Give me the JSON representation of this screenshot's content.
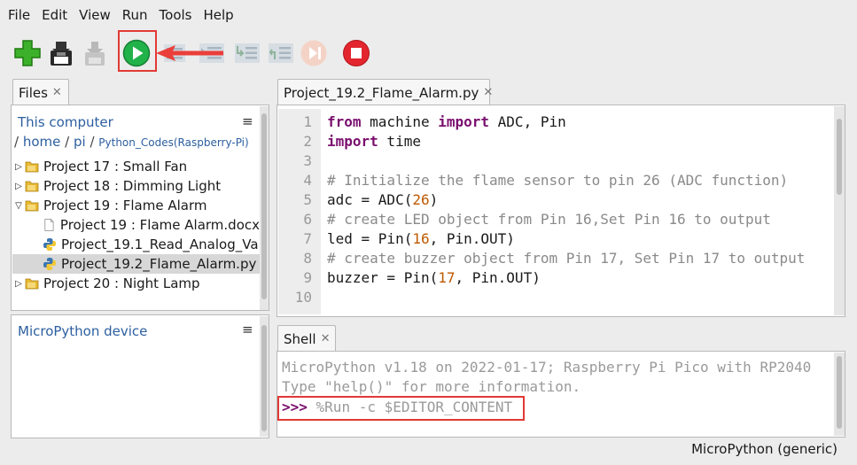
{
  "menu": [
    "File",
    "Edit",
    "View",
    "Run",
    "Tools",
    "Help"
  ],
  "toolbar": {
    "buttons": [
      {
        "name": "new-file",
        "icon": "plus-icon"
      },
      {
        "name": "save-file",
        "icon": "floppy-icon"
      },
      {
        "name": "load-file",
        "icon": "download-icon"
      },
      {
        "name": "run",
        "icon": "play-icon"
      },
      {
        "name": "debug",
        "icon": "debug-icon"
      },
      {
        "name": "step-over",
        "icon": "step-over-icon"
      },
      {
        "name": "step-into",
        "icon": "step-into-icon"
      },
      {
        "name": "step-out",
        "icon": "step-out-icon"
      },
      {
        "name": "resume",
        "icon": "resume-icon"
      },
      {
        "name": "stop",
        "icon": "stop-icon"
      }
    ],
    "accent": "#e23a35"
  },
  "files": {
    "tab_label": "Files",
    "computer_title": "This computer",
    "breadcrumb": [
      "home",
      "pi",
      "Python_Codes(Raspberry-Pi)"
    ],
    "tree": [
      {
        "label": "Project 17 : Small Fan",
        "type": "folder",
        "expanded": false
      },
      {
        "label": "Project 18 : Dimming Light",
        "type": "folder",
        "expanded": false
      },
      {
        "label": "Project 19 : Flame Alarm",
        "type": "folder",
        "expanded": true
      },
      {
        "label": "Project 19 : Flame Alarm.docx",
        "type": "doc"
      },
      {
        "label": "Project_19.1_Read_Analog_Va",
        "type": "python"
      },
      {
        "label": "Project_19.2_Flame_Alarm.py",
        "type": "python",
        "selected": true
      },
      {
        "label": "Project 20 : Night Lamp",
        "type": "folder",
        "expanded": false
      }
    ],
    "device_title": "MicroPython device"
  },
  "editor": {
    "tab_label": "Project_19.2_Flame_Alarm.py",
    "lines": [
      {
        "n": "1",
        "code": "from machine import ADC, Pin"
      },
      {
        "n": "2",
        "code": "import time"
      },
      {
        "n": "3",
        "code": ""
      },
      {
        "n": "4",
        "code": "# Initialize the flame sensor to pin 26 (ADC function)"
      },
      {
        "n": "5",
        "code": "adc = ADC(26)"
      },
      {
        "n": "6",
        "code": "# create LED object from Pin 16,Set Pin 16 to output"
      },
      {
        "n": "7",
        "code": "led = Pin(16, Pin.OUT)"
      },
      {
        "n": "8",
        "code": "# create buzzer object from Pin 17, Set Pin 17 to output"
      },
      {
        "n": "9",
        "code": "buzzer = Pin(17, Pin.OUT)"
      },
      {
        "n": "10",
        "code": ""
      }
    ]
  },
  "shell": {
    "tab_label": "Shell",
    "lines": [
      "MicroPython v1.18 on 2022-01-17; Raspberry Pi Pico with RP2040",
      "Type \"help()\" for more information."
    ],
    "prompt": ">>>",
    "command": " %Run -c $EDITOR_CONTENT"
  },
  "status": {
    "interpreter": "MicroPython (generic)"
  }
}
